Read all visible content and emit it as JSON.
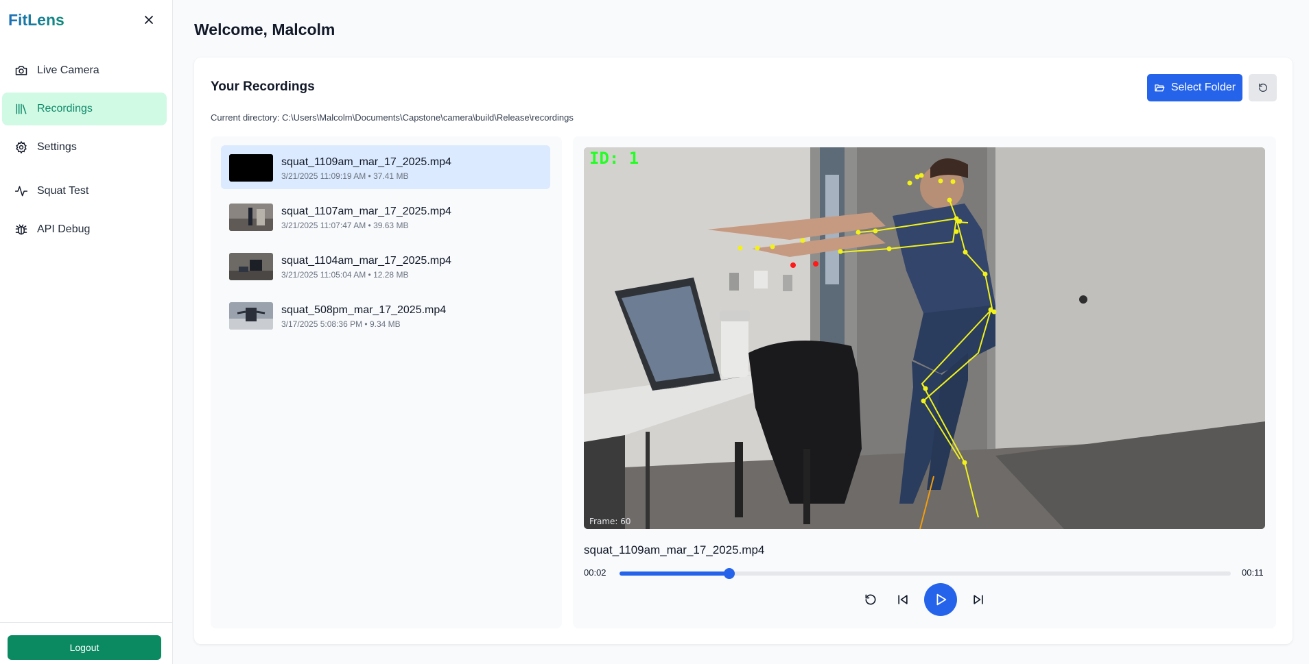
{
  "app": {
    "brand": "FitLens"
  },
  "sidebar": {
    "items": [
      {
        "label": "Live Camera",
        "icon": "camera-icon"
      },
      {
        "label": "Recordings",
        "icon": "library-icon",
        "active": true
      },
      {
        "label": "Settings",
        "icon": "gear-icon"
      },
      {
        "label": "Squat Test",
        "icon": "activity-icon"
      },
      {
        "label": "API Debug",
        "icon": "bug-icon"
      }
    ],
    "logout_label": "Logout"
  },
  "header": {
    "welcome": "Welcome, Malcolm"
  },
  "recordings": {
    "title": "Your Recordings",
    "select_folder_label": "Select Folder",
    "current_directory": "Current directory: C:\\Users\\Malcolm\\Documents\\Capstone\\camera\\build\\Release\\recordings",
    "items": [
      {
        "name": "squat_1109am_mar_17_2025.mp4",
        "meta": "3/21/2025 11:09:19 AM • 37.41 MB",
        "selected": true
      },
      {
        "name": "squat_1107am_mar_17_2025.mp4",
        "meta": "3/21/2025 11:07:47 AM • 39.63 MB"
      },
      {
        "name": "squat_1104am_mar_17_2025.mp4",
        "meta": "3/21/2025 11:05:04 AM • 12.28 MB"
      },
      {
        "name": "squat_508pm_mar_17_2025.mp4",
        "meta": "3/17/2025 5:08:36 PM • 9.34 MB"
      }
    ]
  },
  "player": {
    "overlay_id": "ID: 1",
    "overlay_frame": "Frame: 60",
    "title": "squat_1109am_mar_17_2025.mp4",
    "time_current": "00:02",
    "time_total": "00:11",
    "progress": 0.18
  },
  "colors": {
    "accent": "#2563eb",
    "brand_green": "#0b8a62",
    "active_nav_bg": "#d1fae5"
  }
}
